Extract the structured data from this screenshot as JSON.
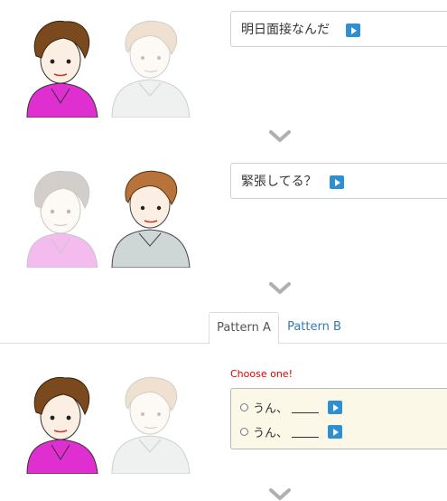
{
  "dialogue": [
    {
      "speaker": "left",
      "text": "明日面接なんだ"
    },
    {
      "speaker": "right",
      "text": "緊張してる？"
    }
  ],
  "tabs": [
    {
      "label": "Pattern A",
      "active": true
    },
    {
      "label": "Pattern B",
      "active": false
    }
  ],
  "choice_prompt": "Choose one!",
  "choices": [
    {
      "text": "うん、"
    },
    {
      "text": "うん、"
    }
  ],
  "colors": {
    "accent": "#2e8fd2",
    "prompt": "#e00000",
    "choice_bg": "#fcf8e8",
    "link": "#337ab7"
  },
  "icons": [
    "play-icon",
    "chevron-down-icon",
    "radio-icon"
  ]
}
